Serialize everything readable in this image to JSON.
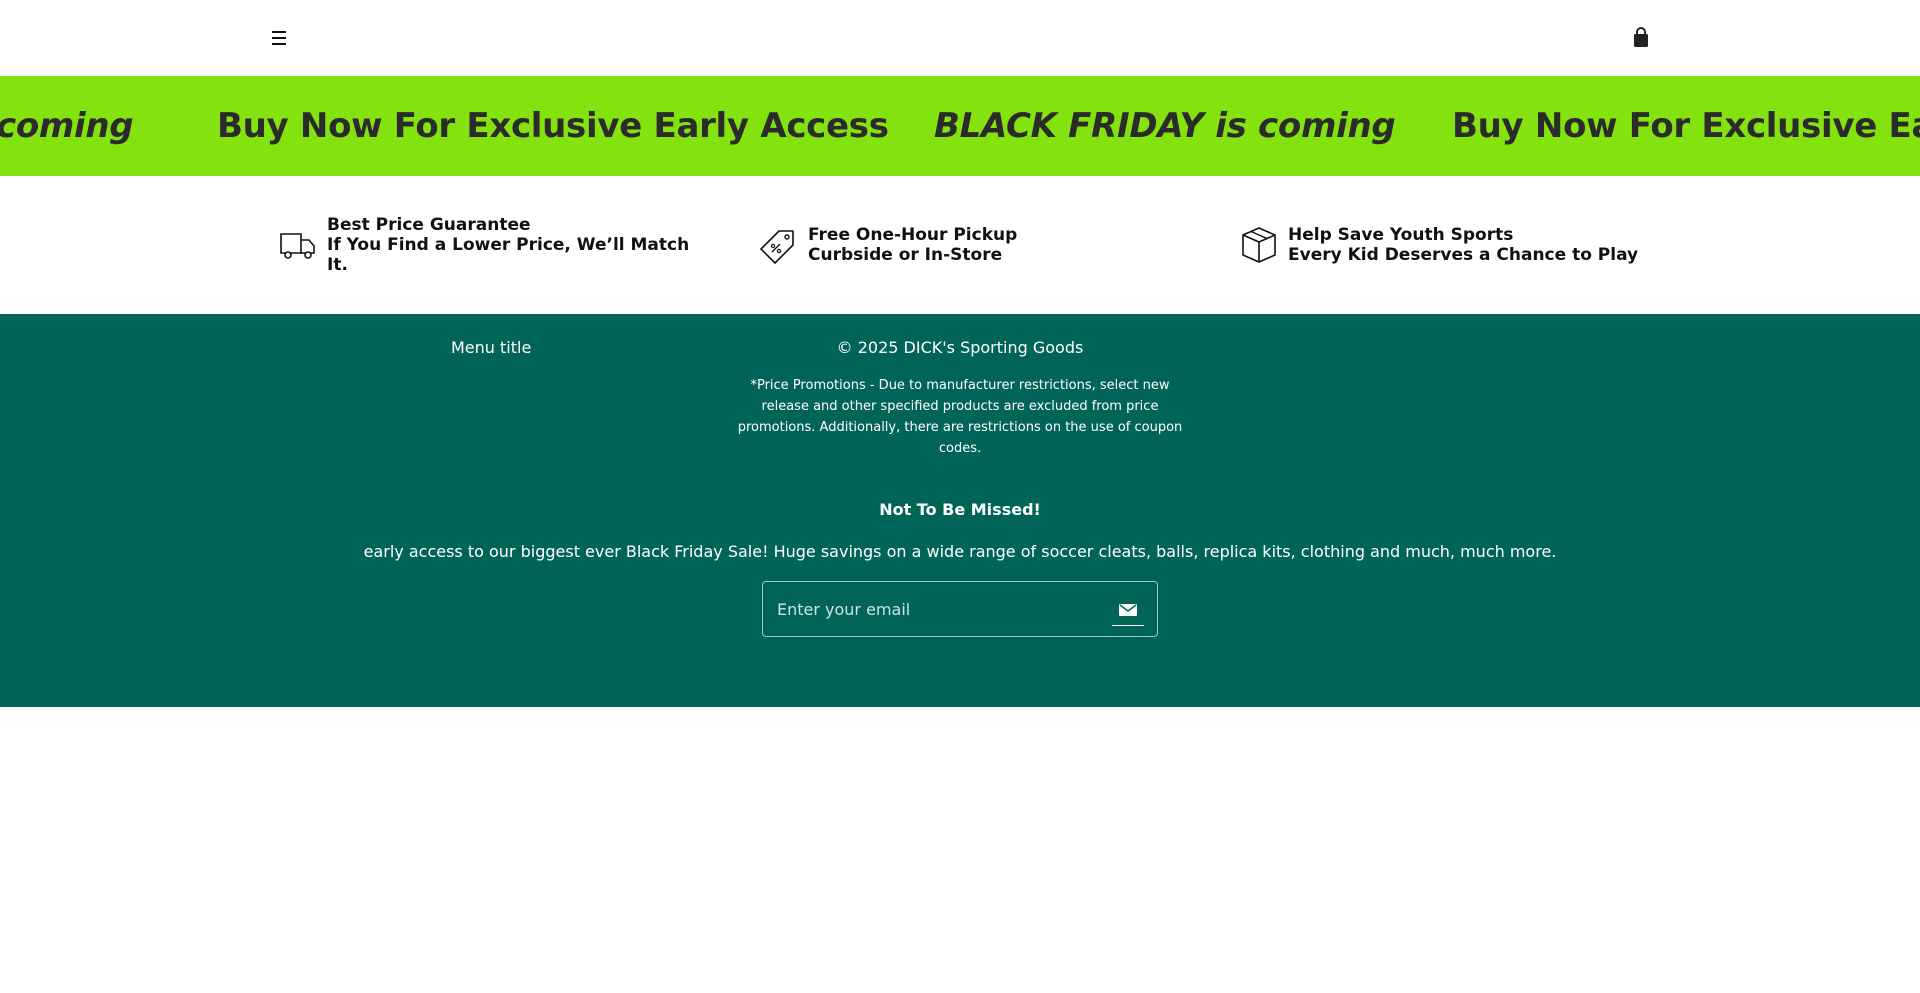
{
  "header": {
    "menu_icon": "hamburger-icon",
    "cart_icon": "shopping-bag-icon"
  },
  "marquee": {
    "items": [
      "coming",
      "Buy Now For Exclusive Early Access",
      "BLACK FRIDAY is coming",
      "Buy Now For Exclusive Ear"
    ],
    "background": "#84e30f"
  },
  "features": [
    {
      "icon": "delivery-truck-icon",
      "title": "Best Price Guarantee",
      "line2": "If You Find a Lower Price, We’ll Match",
      "line3": "It."
    },
    {
      "icon": "price-tag-icon",
      "title": "Free One-Hour Pickup",
      "line2": "Curbside or In-Store"
    },
    {
      "icon": "box-icon",
      "title": "Help Save Youth Sports",
      "line2": "Every Kid Deserves a Chance to Play"
    }
  ],
  "footer": {
    "background": "#006557",
    "menu_title": "Menu title",
    "copyright": "© 2025 DICK's Sporting Goods",
    "disclaimer": "*Price Promotions - Due to manufacturer restrictions, select new release and other specified products are excluded from price promotions. Additionally, there are restrictions on the use of coupon codes.",
    "newsletter": {
      "title": "Not To Be Missed!",
      "text": "early access to our biggest ever Black Friday Sale! Huge savings on a wide range of soccer cleats, balls, replica kits, clothing and much, much more.",
      "placeholder": "Enter your email",
      "submit_icon": "envelope-icon"
    }
  }
}
